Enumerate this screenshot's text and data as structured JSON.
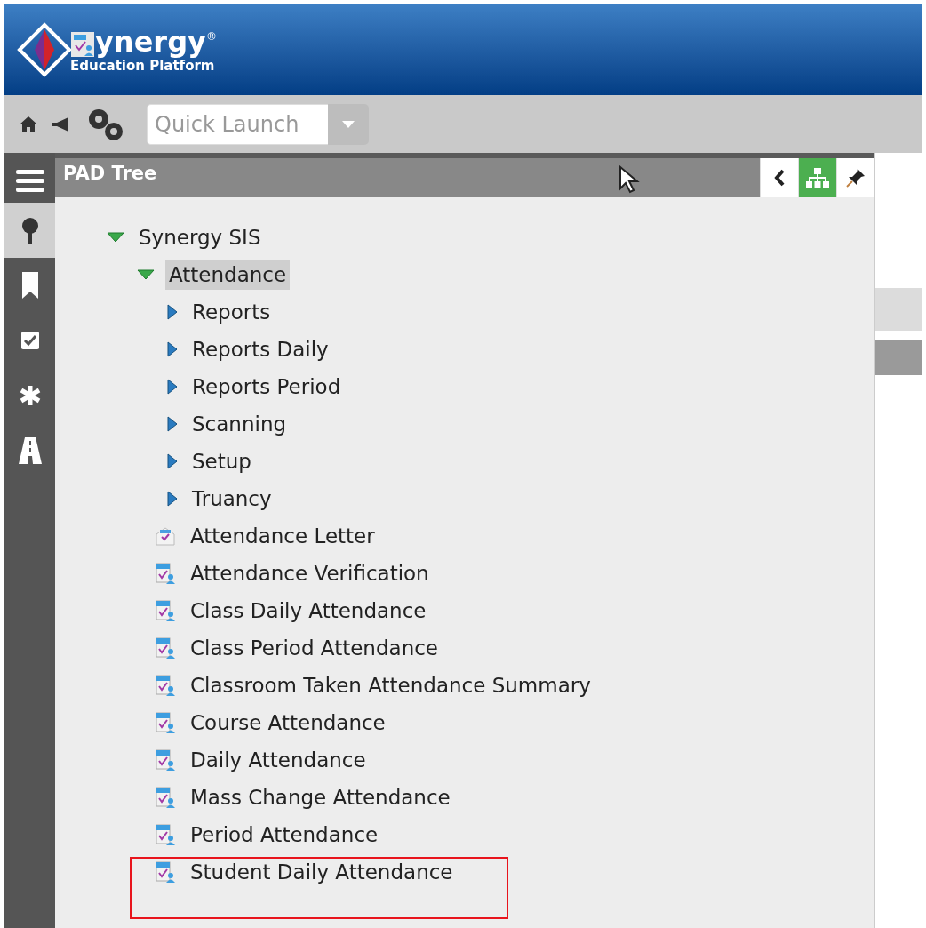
{
  "header": {
    "brand": "ynergy",
    "trademark": "®",
    "subtitle": "Education Platform"
  },
  "toolbar": {
    "quick_launch": {
      "placeholder": "Quick Launch"
    }
  },
  "sidebar": {
    "items": [
      {
        "selected": true
      },
      {
        "selected": false
      },
      {
        "selected": false
      },
      {
        "selected": false
      },
      {
        "selected": false
      }
    ]
  },
  "panel": {
    "title": "PAD Tree",
    "tools": [
      {
        "selected": false
      },
      {
        "selected": true
      },
      {
        "selected": false
      }
    ]
  },
  "tree": [
    {
      "label": "Synergy SIS",
      "kind": "folder",
      "expanded": true,
      "selected": false,
      "children": [
        {
          "label": "Attendance",
          "kind": "folder",
          "expanded": true,
          "selected": true,
          "children": [
            {
              "label": "Reports",
              "kind": "folder",
              "expanded": false,
              "selected": false
            },
            {
              "label": "Reports Daily",
              "kind": "folder",
              "expanded": false,
              "selected": false
            },
            {
              "label": "Reports Period",
              "kind": "folder",
              "expanded": false,
              "selected": false
            },
            {
              "label": "Scanning",
              "kind": "folder",
              "expanded": false,
              "selected": false
            },
            {
              "label": "Setup",
              "kind": "folder",
              "expanded": false,
              "selected": false
            },
            {
              "label": "Truancy",
              "kind": "folder",
              "expanded": false,
              "selected": false
            },
            {
              "label": "Attendance Letter",
              "kind": "letter",
              "selected": false
            },
            {
              "label": "Attendance Verification",
              "kind": "page",
              "selected": false
            },
            {
              "label": "Class Daily Attendance",
              "kind": "page",
              "selected": false
            },
            {
              "label": "Class Period Attendance",
              "kind": "page",
              "selected": false
            },
            {
              "label": "Classroom Taken Attendance Summary",
              "kind": "page",
              "selected": false
            },
            {
              "label": "Course Attendance",
              "kind": "page",
              "selected": false
            },
            {
              "label": "Daily Attendance",
              "kind": "page",
              "selected": false
            },
            {
              "label": "Mass Change Attendance",
              "kind": "page",
              "selected": false
            },
            {
              "label": "Period Attendance",
              "kind": "page",
              "selected": false
            },
            {
              "label": "Student Daily Attendance",
              "kind": "page",
              "selected": false,
              "highlighted": true
            }
          ]
        }
      ]
    }
  ]
}
